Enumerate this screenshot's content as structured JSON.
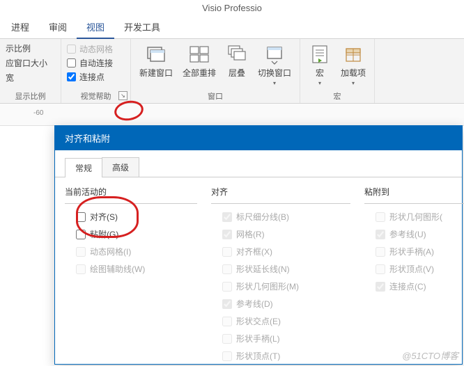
{
  "app": {
    "title": "Visio Professio"
  },
  "tabs": {
    "process": "进程",
    "review": "审阅",
    "view": "视图",
    "dev": "开发工具"
  },
  "ribbon": {
    "zoom": {
      "item1": "示比例",
      "item2": "应窗口大小",
      "item3": "宽",
      "group_label": "显示比例"
    },
    "visual_aids": {
      "dynamic_grid": "动态网格",
      "auto_connect": "自动连接",
      "connection_points": "连接点",
      "group_label": "视觉帮助"
    },
    "window": {
      "new_window": "新建窗口",
      "arrange_all": "全部重排",
      "cascade": "层叠",
      "switch_windows": "切换窗口",
      "group_label": "窗口"
    },
    "macros": {
      "macros": "宏",
      "addins": "加载项",
      "group_label": "宏"
    }
  },
  "ruler": {
    "neg60": "-60"
  },
  "dialog": {
    "title": "对齐和粘附",
    "tabs": {
      "general": "常规",
      "advanced": "高级"
    },
    "col1": {
      "header": "当前活动的",
      "snap": "对齐(S)",
      "glue": "粘附(G)",
      "dynamic_grid": "动态网格(I)",
      "drawing_aids": "绘图辅助线(W)"
    },
    "col2": {
      "header": "对齐",
      "ruler_sub": "标尺细分线(B)",
      "grid": "网格(R)",
      "alignment_box": "对齐框(X)",
      "shape_ext": "形状延长线(N)",
      "shape_geom": "形状几何图形(M)",
      "guides": "参考线(D)",
      "shape_intersect": "形状交点(E)",
      "shape_handles": "形状手柄(L)",
      "shape_vertices": "形状顶点(T)"
    },
    "col3": {
      "header": "粘附到",
      "shape_geom": "形状几何图形(",
      "guides": "参考线(U)",
      "shape_handles": "形状手柄(A)",
      "shape_vertices": "形状顶点(V)",
      "connection_points": "连接点(C)"
    }
  },
  "watermark": "@51CTO博客"
}
